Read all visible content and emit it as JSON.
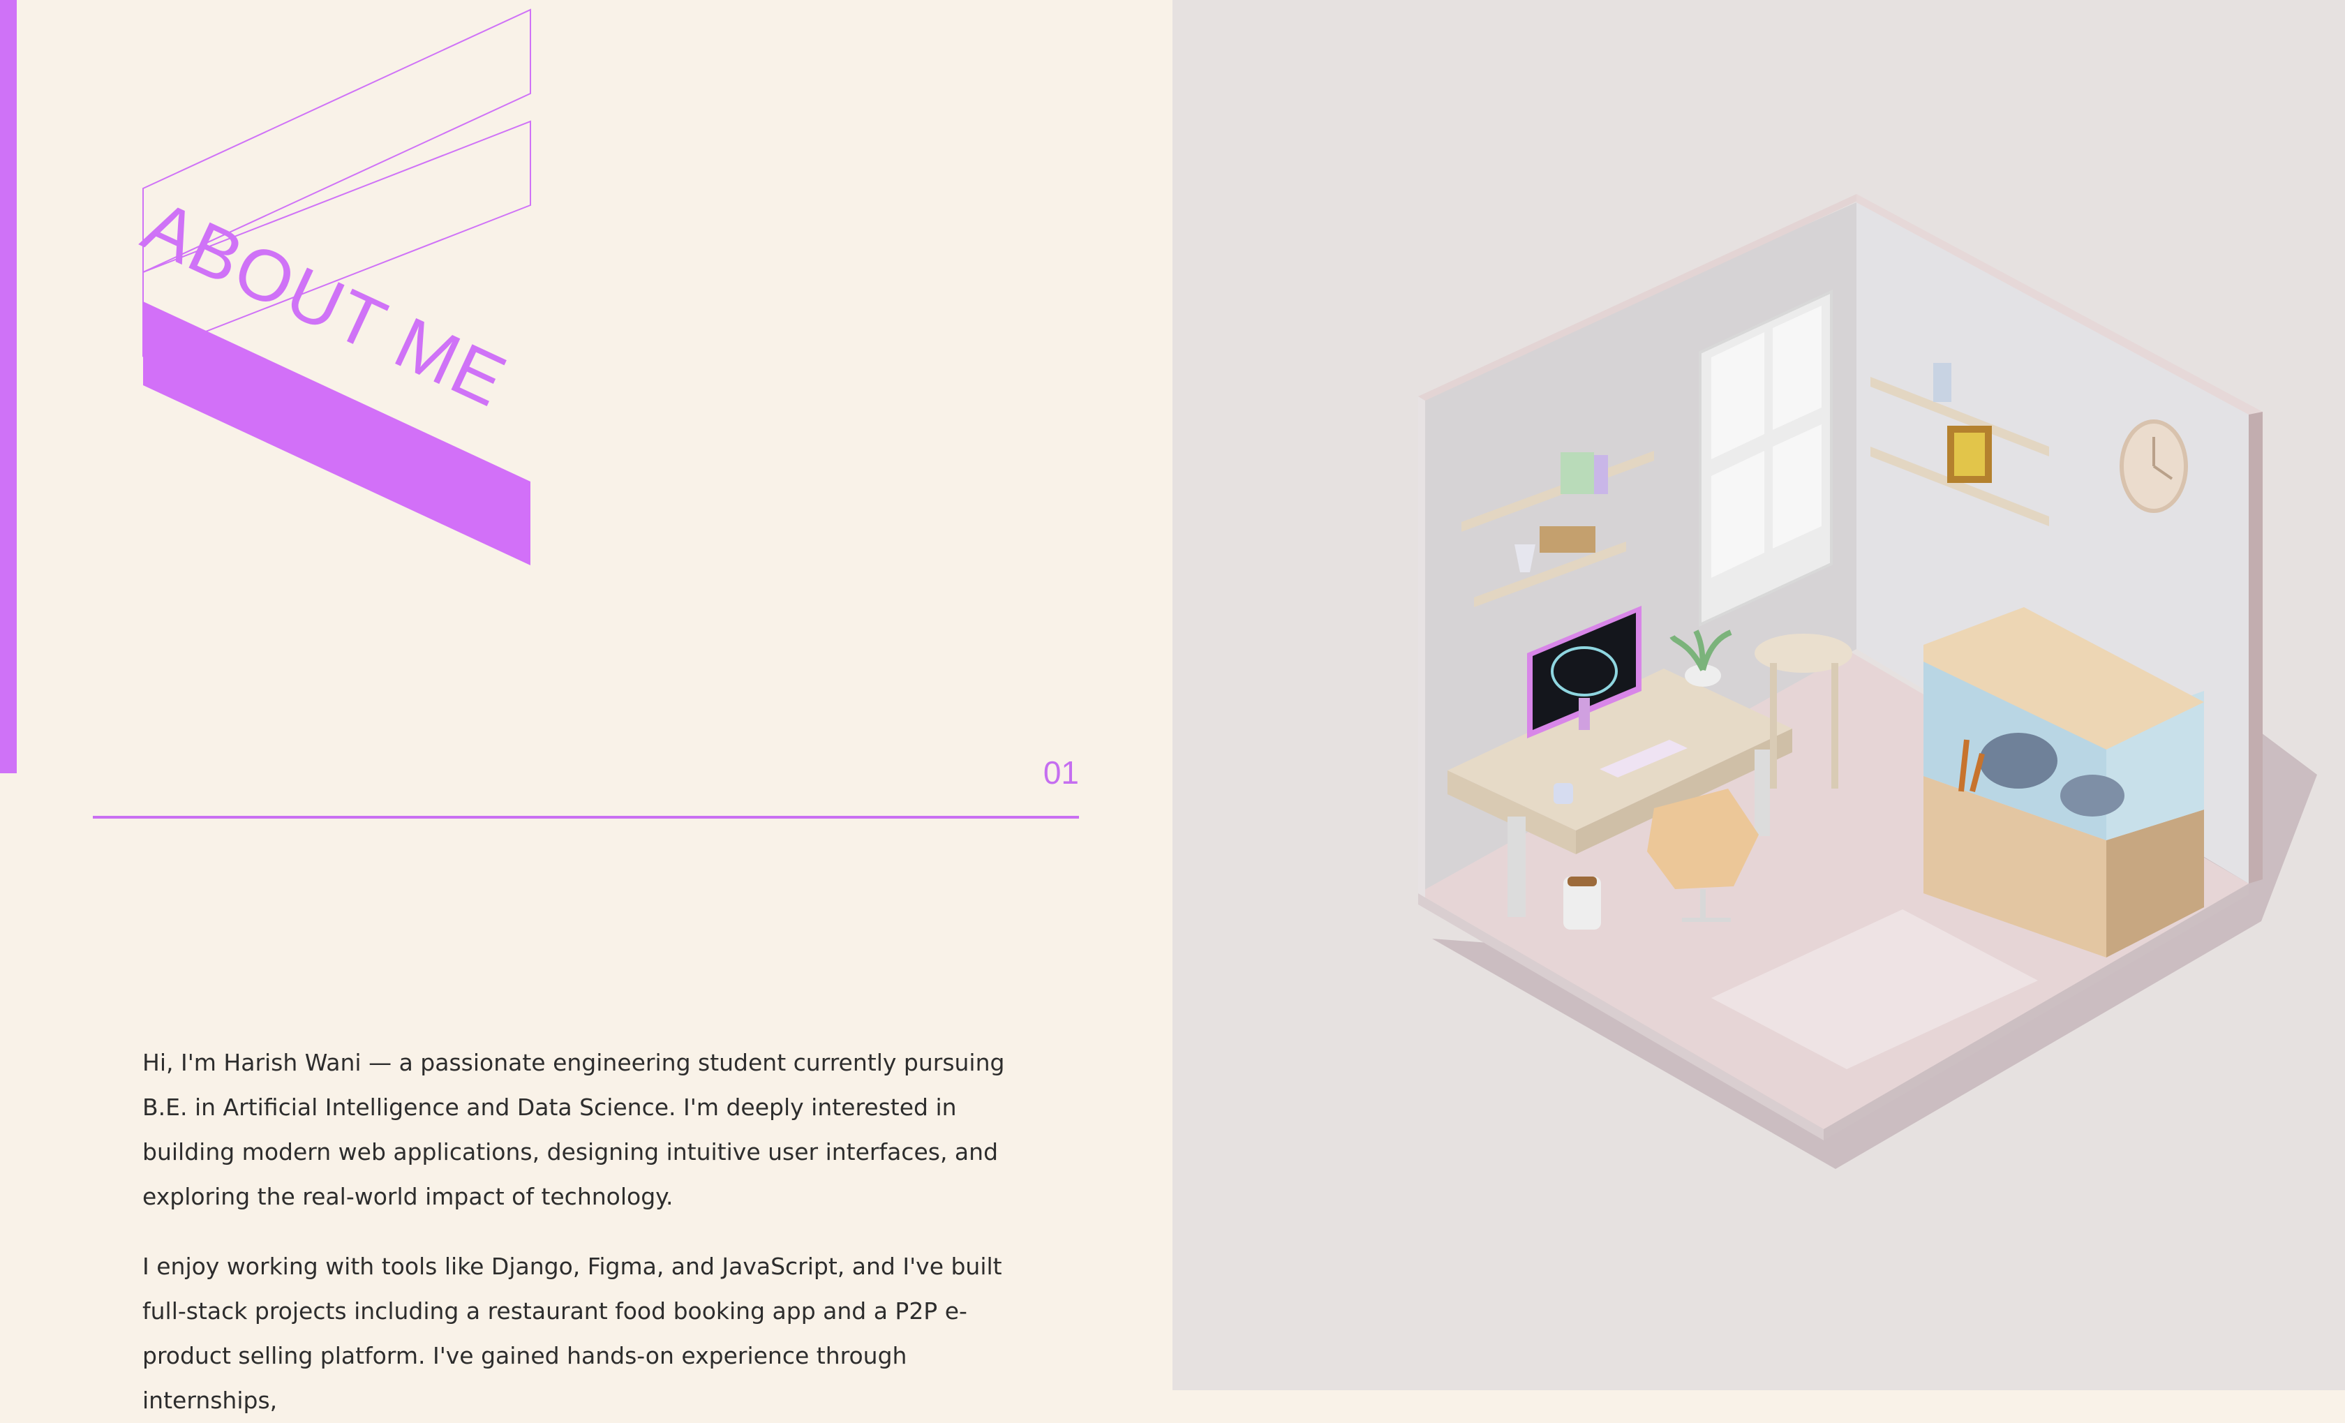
{
  "about_section": {
    "heading": "ABOUT ME",
    "section_number": "01",
    "bio": [
      "Hi, I'm Harish Wani — a passionate engineering student currently pursuing B.E. in Artificial Intelligence and Data Science. I'm deeply interested in building modern web applications, designing intuitive user interfaces, and exploring the real-world impact of technology.",
      "I enjoy working with tools like Django, Figma, and JavaScript, and I've built full-stack projects including a restaurant food booking app and a P2P e-product selling platform. I've gained hands-on experience through internships,"
    ]
  },
  "colors": {
    "accent": "#cf72f7",
    "background_left": "#f9f2e8",
    "background_right": "#e6e1e0",
    "body_text": "#2d2d2d"
  },
  "illustration": {
    "icons": [
      "isometric-room",
      "monitor-icon",
      "keyboard-icon",
      "desk-chair-icon",
      "aquarium-icon",
      "wall-clock-icon",
      "window-icon",
      "bookshelf-icon",
      "potted-plant-icon",
      "side-table-icon",
      "picture-frame-icon",
      "desk-lamp-icon",
      "air-purifier-icon",
      "rug-icon"
    ]
  }
}
